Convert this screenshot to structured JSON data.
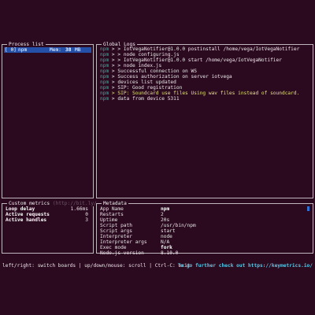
{
  "process_list": {
    "title": "Process list",
    "selected": {
      "id": "[ 0]",
      "name": "npm",
      "mem_label": "Mem:",
      "mem_value": "38",
      "mem_unit": "MB"
    }
  },
  "global_logs": {
    "title": "Global Logs",
    "lines": [
      {
        "app": "npm",
        "text": "> > IotVegaNotifier@1.0.0 postinstall /home/vega/IotVegaNotifier",
        "hl": false
      },
      {
        "app": "npm",
        "text": "> > node configuring.js",
        "hl": false
      },
      {
        "app": "npm",
        "text": "> > IotVegaNotifier@1.0.0 start /home/vega/IotVegaNotifier",
        "hl": false
      },
      {
        "app": "npm",
        "text": "> > node index.js",
        "hl": false
      },
      {
        "app": "npm",
        "text": "> Successful connection on WS",
        "hl": false
      },
      {
        "app": "npm",
        "text": "> Success authorization on server iotvega",
        "hl": false
      },
      {
        "app": "npm",
        "text": "> devices list updated",
        "hl": false
      },
      {
        "app": "npm",
        "text": "> SIP: Good registration",
        "hl": false
      },
      {
        "app": "npm",
        "text": "> SIP: Soundcard use files Using wav files instead of soundcard.",
        "hl": true
      },
      {
        "app": "npm",
        "text": "> data from device 5311",
        "hl": false
      }
    ]
  },
  "custom_metrics": {
    "title": "Custom metrics",
    "title_hint": "(http://bit.ly/",
    "rows": [
      {
        "key": "Loop delay",
        "value": "1.66ms"
      },
      {
        "key": "Active requests",
        "value": "0"
      },
      {
        "key": "Active handles",
        "value": "3"
      }
    ]
  },
  "metadata": {
    "title": "Metadata",
    "rows": [
      {
        "key": "App Name",
        "value": "npm",
        "bold": true
      },
      {
        "key": "Restarts",
        "value": "2",
        "bold": false
      },
      {
        "key": "Uptime",
        "value": "20s",
        "bold": false
      },
      {
        "key": "Script path",
        "value": "/usr/bin/npm",
        "bold": false
      },
      {
        "key": "Script args",
        "value": "start",
        "bold": false
      },
      {
        "key": "Interpreter",
        "value": "node",
        "bold": false
      },
      {
        "key": "Interpreter args",
        "value": "N/A",
        "bold": false
      },
      {
        "key": "Exec mode",
        "value": "fork",
        "bold": true
      },
      {
        "key": "Node.js version",
        "value": "8.10.0",
        "bold": false
      }
    ]
  },
  "footer": {
    "help": "left/right: switch boards | up/down/mouse: scroll | Ctrl-C: exit",
    "promo": "To go further check out https://keymetrics.io/"
  }
}
